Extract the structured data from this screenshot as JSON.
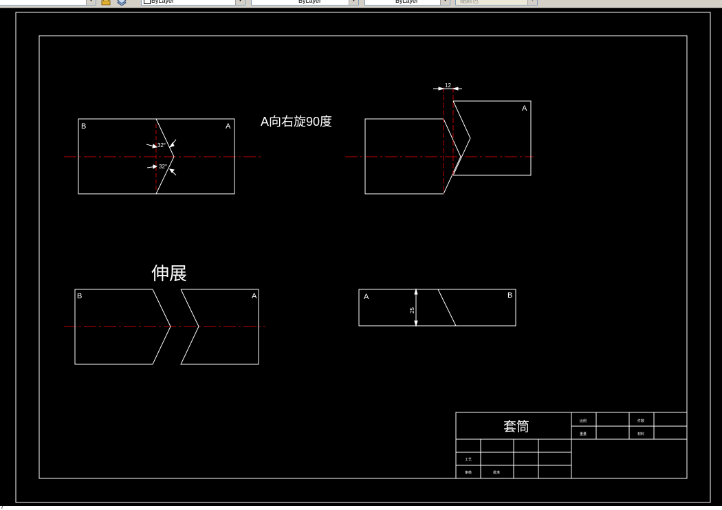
{
  "toolbar": {
    "color_control": "ByLayer",
    "linetype_control": "ByLayer",
    "lineweight_control": "ByLayer",
    "plotstyle_control": "随颜色"
  },
  "colors": {
    "background": "#000000",
    "geometry": "#ffffff",
    "centerline": "#c00000"
  },
  "drawing": {
    "view_label_b": "B",
    "view_label_a": "A",
    "angle_dim": "32°",
    "rotate_note": "A向右旋90度",
    "offset_dim": "12",
    "unfold_title": "伸展",
    "height_dim": "25"
  },
  "title_block": {
    "part_name": "套筒",
    "ratio_label": "比例",
    "qty_label": "件数",
    "weight_label": "重量",
    "material_label": "材料",
    "process_label": "工艺",
    "review_label": "审核",
    "approve_label": "批准"
  },
  "status": {
    "text": "7"
  }
}
